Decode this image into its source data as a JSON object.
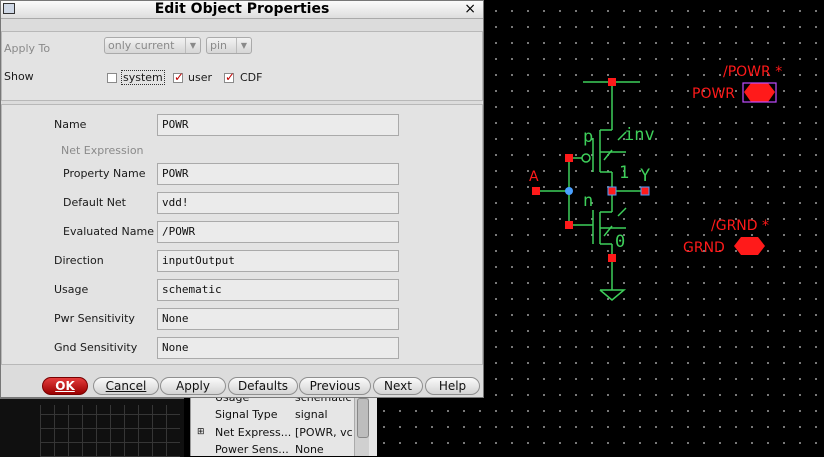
{
  "dialog": {
    "title": "Edit Object Properties",
    "close_glyph": "×",
    "apply_to": {
      "label": "Apply To",
      "scope_value": "only current",
      "type_value": "pin"
    },
    "show": {
      "label": "Show",
      "checkboxes": [
        {
          "label": "system",
          "checked": false
        },
        {
          "label": "user",
          "checked": true
        },
        {
          "label": "CDF",
          "checked": true
        }
      ]
    },
    "fields": {
      "name_label": "Name",
      "name_value": "POWR",
      "net_expression_label": "Net Expression",
      "property_name_label": "Property Name",
      "property_name_value": "POWR",
      "default_net_label": "Default Net",
      "default_net_value": "vdd!",
      "evaluated_name_label": "Evaluated Name",
      "evaluated_name_value": "/POWR",
      "direction_label": "Direction",
      "direction_value": "inputOutput",
      "usage_label": "Usage",
      "usage_value": "schematic",
      "pwr_label": "Pwr Sensitivity",
      "pwr_value": "None",
      "gnd_label": "Gnd Sensitivity",
      "gnd_value": "None"
    },
    "buttons": {
      "ok": "OK",
      "cancel": "Cancel",
      "apply": "Apply",
      "defaults": "Defaults",
      "previous": "Previous",
      "next": "Next",
      "help": "Help"
    }
  },
  "property_panel": {
    "rows": [
      {
        "expander": "",
        "key": "Usage",
        "value": "schematic"
      },
      {
        "expander": "",
        "key": "Signal Type",
        "value": "signal"
      },
      {
        "expander": "⊞",
        "key": "Net Express...",
        "value": "[POWR, vc"
      },
      {
        "expander": "",
        "key": "Power Sens...",
        "value": "None"
      }
    ]
  },
  "schematic": {
    "pin_powr_top": "/POWR *",
    "pin_powr": "POWR",
    "pin_grnd_top": "/GRND *",
    "pin_grnd": "GRND",
    "input_a": "A",
    "output_y": "Y",
    "cell": "inv",
    "pmos": "p",
    "nmos": "n",
    "pmos_m": "1",
    "nmos_m": "0",
    "colors": {
      "wire": "#3ecf5a",
      "pin": "#ff1a1a",
      "background": "#000000"
    }
  }
}
